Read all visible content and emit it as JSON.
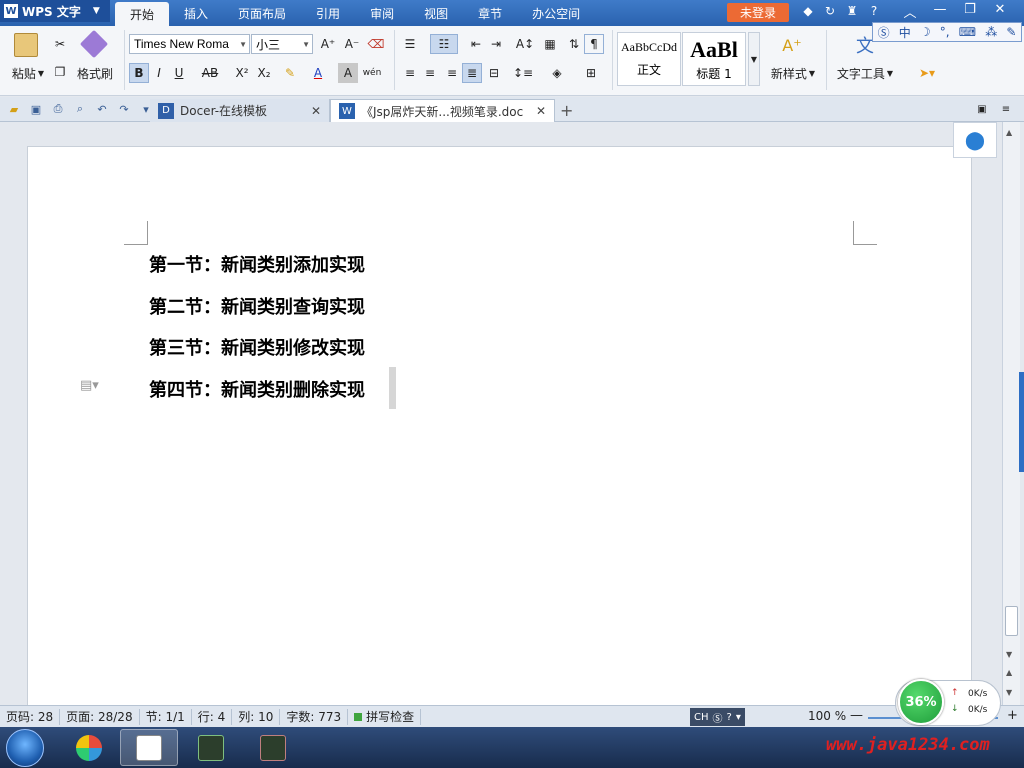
{
  "app": {
    "name": "WPS 文字",
    "logo_letter": "W",
    "menu_tabs": [
      "开始",
      "插入",
      "页面布局",
      "引用",
      "审阅",
      "视图",
      "章节",
      "办公空间"
    ],
    "active_tab": "开始",
    "login_label": "未登录",
    "window_controls": [
      "︿",
      "—",
      "❐",
      "✕"
    ]
  },
  "ime_bar": {
    "items": [
      "中",
      "☽",
      "°,",
      "⌨",
      "⁂",
      "✎"
    ]
  },
  "ribbon": {
    "paste_label": "粘贴",
    "format_painter_label": "格式刷",
    "font_name": "Times New Roma",
    "font_size": "小三",
    "bold": "B",
    "italic": "I",
    "underline": "U",
    "strikethrough": "AB",
    "superscript": "X²",
    "subscript": "X₂",
    "font_color": "A",
    "char_shading": "A",
    "phonetic": "wén",
    "grow_font": "A⁺",
    "shrink_font": "A⁻",
    "style_normal_preview": "AaBbCcDd",
    "style_normal_label": "正文",
    "style_heading_preview": "AaBl",
    "style_heading_label": "标题 1",
    "new_style_label": "新样式",
    "text_tools_label": "文字工具"
  },
  "tabbar": {
    "docer_tab": "Docer-在线模板",
    "current_doc_tab": "《Jsp屌炸天新...视频笔录.doc",
    "close_glyph": "✕",
    "add_glyph": "+"
  },
  "document": {
    "headings": [
      "第一节：新闻类别添加实现",
      "第二节：新闻类别查询实现",
      "第三节：新闻类别修改实现",
      "第四节：新闻类别删除实现"
    ]
  },
  "statusbar": {
    "page_code": "页码: 28",
    "pages": "页面: 28/28",
    "section": "节: 1/1",
    "line": "行: 4",
    "column": "列: 10",
    "word_count": "字数: 773",
    "spell_check": "拼写检查",
    "ime_lang": "CH",
    "zoom": "100 %"
  },
  "speed_widget": {
    "percent": "36%",
    "upload": "0K/s",
    "download": "0K/s"
  },
  "taskbar": {
    "watermark": "www.java1234.com"
  },
  "colors": {
    "title_blue": "#2a62ae",
    "login_orange": "#ec6a34",
    "accent_blue": "#2a7fd4",
    "speed_green": "#1e9d3a",
    "watermark_red": "#e02020"
  }
}
